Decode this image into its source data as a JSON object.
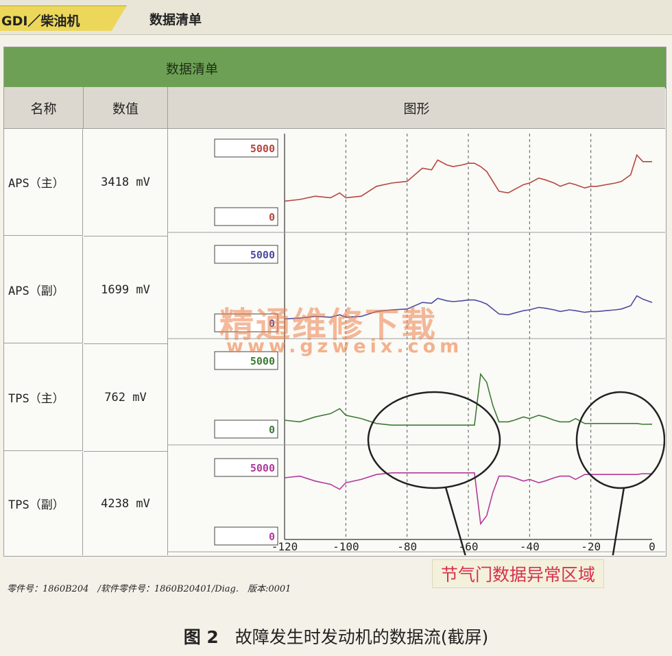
{
  "tabs": {
    "active_label": "GDI／柴油机",
    "title": "数据清单"
  },
  "panel": {
    "header": "数据清单",
    "columns": {
      "name": "名称",
      "value": "数值",
      "graph": "图形"
    }
  },
  "rows": [
    {
      "name": "APS（主）",
      "value": "3418 mV",
      "max": "5000",
      "min": "0",
      "color": "#b5463e"
    },
    {
      "name": "APS（副）",
      "value": "1699 mV",
      "max": "5000",
      "min": "0",
      "color": "#4d4aa0"
    },
    {
      "name": "TPS（主）",
      "value": "762 mV",
      "max": "5000",
      "min": "0",
      "color": "#3d7a34"
    },
    {
      "name": "TPS（副）",
      "value": "4238 mV",
      "max": "5000",
      "min": "0",
      "color": "#b2389a"
    }
  ],
  "chart_data": {
    "type": "line",
    "xlim": [
      -120,
      0
    ],
    "ylim": [
      0,
      5000
    ],
    "x_ticks": [
      "-120",
      "-100",
      "-80",
      "-60",
      "-40",
      "-20",
      "0"
    ],
    "grid": "vertical dashed",
    "x": [
      -120,
      -115,
      -110,
      -105,
      -102,
      -100,
      -95,
      -90,
      -85,
      -80,
      -75,
      -72,
      -70,
      -67,
      -65,
      -62,
      -60,
      -58,
      -56,
      -54,
      -52,
      -50,
      -47,
      -45,
      -42,
      -40,
      -37,
      -35,
      -32,
      -30,
      -27,
      -25,
      -22,
      -20,
      -18,
      -15,
      -12,
      -10,
      -7,
      -5,
      -3,
      0
    ],
    "series": [
      {
        "label": "APS（主）",
        "values": [
          1400,
          1500,
          1700,
          1600,
          1900,
          1600,
          1700,
          2300,
          2500,
          2600,
          3400,
          3300,
          3900,
          3600,
          3500,
          3600,
          3700,
          3700,
          3500,
          3200,
          2600,
          2000,
          1900,
          2100,
          2400,
          2500,
          2800,
          2700,
          2500,
          2300,
          2500,
          2400,
          2200,
          2300,
          2300,
          2400,
          2500,
          2600,
          3000,
          4200,
          3800,
          3800
        ]
      },
      {
        "label": "APS（副）",
        "values": [
          700,
          750,
          850,
          800,
          950,
          800,
          850,
          1150,
          1250,
          1300,
          1700,
          1650,
          1950,
          1800,
          1750,
          1800,
          1850,
          1850,
          1750,
          1600,
          1300,
          1000,
          950,
          1050,
          1200,
          1250,
          1400,
          1350,
          1250,
          1150,
          1250,
          1200,
          1100,
          1150,
          1150,
          1200,
          1250,
          1300,
          1500,
          2100,
          1900,
          1700
        ]
      },
      {
        "label": "TPS（主）",
        "values": [
          1000,
          900,
          1200,
          1400,
          1700,
          1300,
          1100,
          800,
          700,
          700,
          700,
          700,
          700,
          700,
          700,
          700,
          700,
          700,
          3800,
          3300,
          1900,
          900,
          900,
          1000,
          1200,
          1100,
          1300,
          1200,
          1000,
          900,
          900,
          1100,
          800,
          800,
          800,
          800,
          800,
          800,
          800,
          800,
          750,
          760
        ]
      },
      {
        "label": "TPS（副）",
        "values": [
          4000,
          4100,
          3800,
          3600,
          3300,
          3700,
          3900,
          4200,
          4300,
          4300,
          4300,
          4300,
          4300,
          4300,
          4300,
          4300,
          4300,
          4300,
          1200,
          1700,
          3100,
          4100,
          4100,
          4000,
          3800,
          3900,
          3700,
          3800,
          4000,
          4100,
          4100,
          3900,
          4200,
          4200,
          4200,
          4200,
          4200,
          4200,
          4200,
          4200,
          4250,
          4240
        ]
      }
    ]
  },
  "annotation": "节气门数据异常区域",
  "footer": "零件号：1860B204　/软件零件号：1860B20401/Diag.　版本:0001",
  "caption": {
    "figure": "图 2",
    "text": "故障发生时发动机的数据流(截屏)"
  },
  "watermark": {
    "line1": "精通维修下载",
    "line2": "www.gzweix.com"
  }
}
